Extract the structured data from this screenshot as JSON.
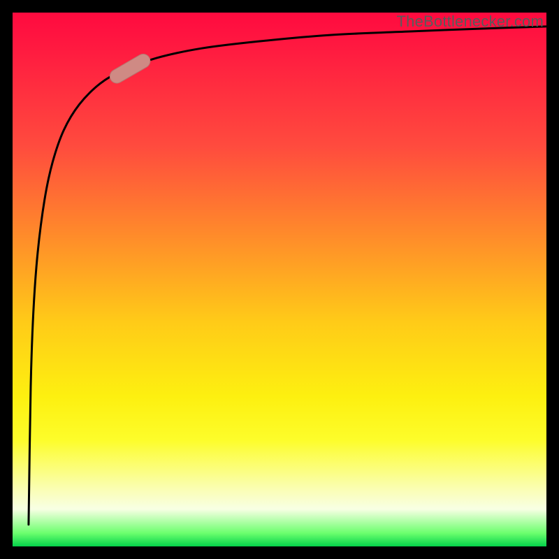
{
  "watermark": "TheBottlenecker.com",
  "colors": {
    "frame": "#000000",
    "curve": "#000000",
    "marker_fill": "#cf8a84",
    "marker_stroke": "#b77670",
    "gradient_top": "#ff0a3f",
    "gradient_bottom": "#04d24a"
  },
  "chart_data": {
    "type": "line",
    "title": "",
    "xlabel": "",
    "ylabel": "",
    "xlim": [
      0,
      100
    ],
    "ylim": [
      0,
      100
    ],
    "curve_points": [
      [
        3.0,
        4.1
      ],
      [
        3.4,
        30.0
      ],
      [
        3.9,
        44.0
      ],
      [
        4.7,
        55.0
      ],
      [
        6.0,
        65.0
      ],
      [
        7.5,
        72.0
      ],
      [
        9.6,
        78.0
      ],
      [
        12.5,
        82.8
      ],
      [
        16.4,
        86.7
      ],
      [
        20.7,
        89.2
      ],
      [
        27.0,
        91.5
      ],
      [
        35.4,
        93.3
      ],
      [
        46.0,
        94.6
      ],
      [
        59.5,
        95.8
      ],
      [
        75.2,
        96.5
      ],
      [
        91.0,
        97.1
      ],
      [
        100.0,
        97.4
      ]
    ],
    "marker": {
      "x_center": 22.0,
      "y_center": 89.5,
      "length": 8.3,
      "width": 2.6,
      "angle_deg": 30
    },
    "background": {
      "type": "vertical_gradient",
      "stops": [
        {
          "pos": 0.0,
          "color": "#ff0a3f"
        },
        {
          "pos": 0.25,
          "color": "#ff4b3e"
        },
        {
          "pos": 0.5,
          "color": "#ffb720"
        },
        {
          "pos": 0.72,
          "color": "#fdf010"
        },
        {
          "pos": 0.89,
          "color": "#fafeb0"
        },
        {
          "pos": 0.975,
          "color": "#6cff6e"
        },
        {
          "pos": 1.0,
          "color": "#04d24a"
        }
      ]
    }
  }
}
